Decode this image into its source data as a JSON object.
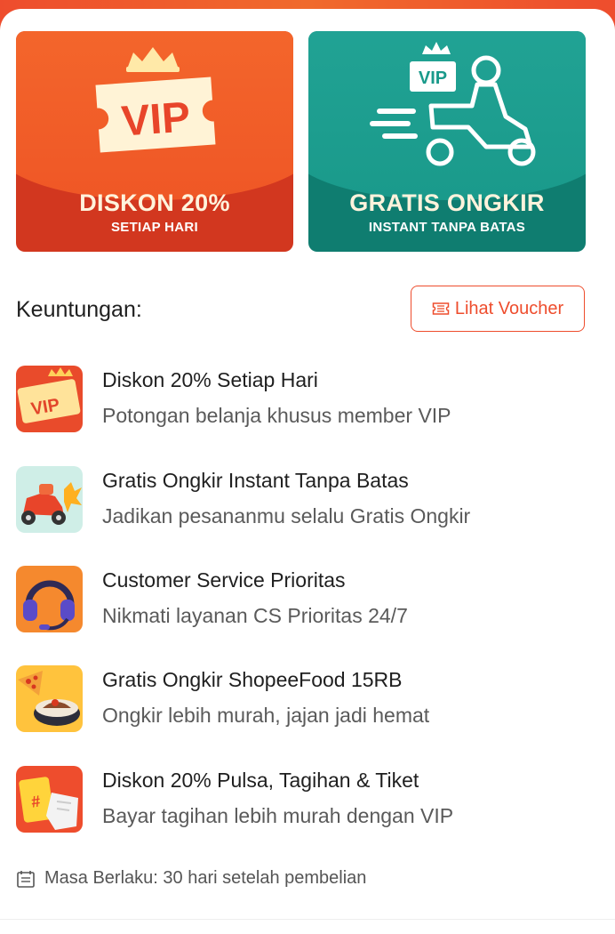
{
  "banners": {
    "vip": {
      "badge": "VIP",
      "title": "DISKON 20%",
      "subtitle": "SETIAP HARI",
      "color": "#d2371f"
    },
    "ongkir": {
      "badge": "VIP",
      "title": "GRATIS ONGKIR",
      "subtitle": "INSTANT TANPA BATAS",
      "color": "#0f7d70"
    }
  },
  "benefits_section": {
    "label": "Keuntungan:",
    "voucher_button": "Lihat Voucher",
    "items": [
      {
        "title": "Diskon 20% Setiap Hari",
        "description": "Potongan belanja khusus member VIP",
        "icon": "vip-ticket-icon"
      },
      {
        "title": "Gratis Ongkir Instant Tanpa Batas",
        "description": "Jadikan pesananmu selalu Gratis Ongkir",
        "icon": "scooter-icon"
      },
      {
        "title": "Customer Service Prioritas",
        "description": "Nikmati layanan CS Prioritas 24/7",
        "icon": "headset-icon"
      },
      {
        "title": "Gratis Ongkir ShopeeFood 15RB",
        "description": "Ongkir lebih murah, jajan jadi hemat",
        "icon": "food-icon"
      },
      {
        "title": "Diskon 20% Pulsa, Tagihan & Tiket",
        "description": "Bayar tagihan lebih murah dengan VIP",
        "icon": "bill-icon"
      }
    ]
  },
  "validity": {
    "text": "Masa Berlaku: 30 hari setelah pembelian",
    "icon": "calendar-icon"
  },
  "colors": {
    "accent": "#ee4d2d",
    "teal": "#0f7d70"
  }
}
